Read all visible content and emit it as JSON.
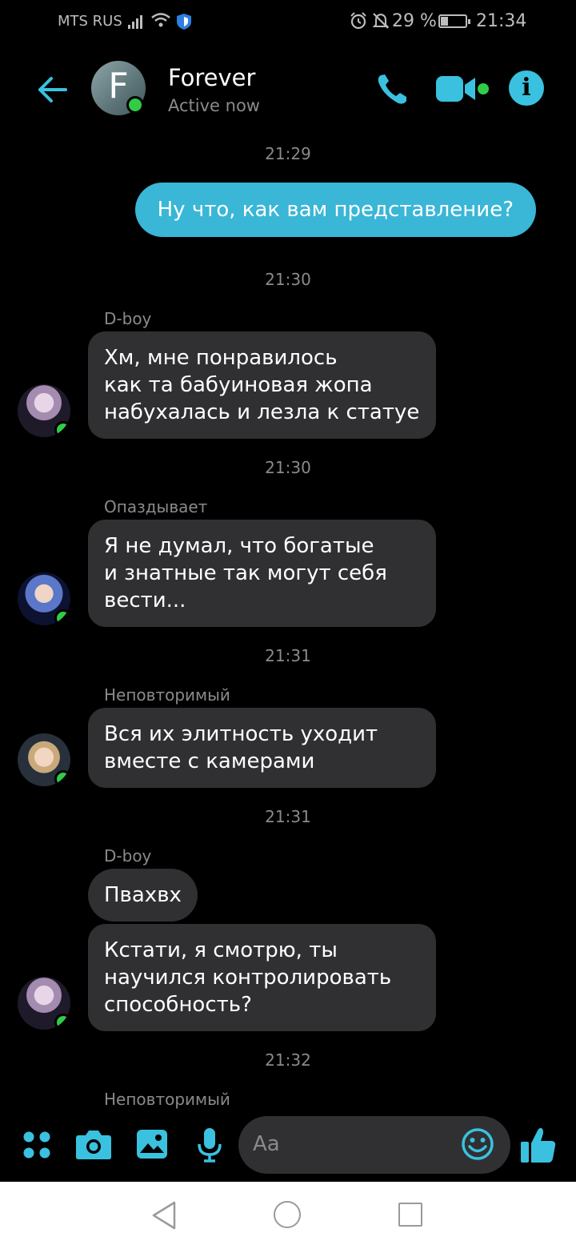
{
  "status_bar": {
    "carrier": "MTS RUS",
    "battery_percent": "29 %",
    "battery_level": 0.29,
    "time": "21:34",
    "icons": [
      "signal-icon",
      "wifi-icon",
      "shield-icon",
      "alarm-icon",
      "bell-off-icon",
      "battery-icon"
    ]
  },
  "header": {
    "avatar_letter": "F",
    "name": "Forever",
    "status": "Active now",
    "icons": [
      "back-arrow-icon",
      "phone-icon",
      "video-icon",
      "info-icon"
    ]
  },
  "accent": "#3ab6d6",
  "messages": [
    {
      "timestamp": "21:29",
      "outgoing": true,
      "text": "Ну что, как вам представление?"
    },
    {
      "timestamp": "21:30",
      "sender": "D-boy",
      "text": "Хм, мне понравилось\nкак та бабуиновая жопа\nнабухалась и лезла к статуе"
    },
    {
      "timestamp": "21:30",
      "sender": "Опаздывает",
      "text": "Я не думал, что богатые\nи знатные так могут себя\nвести..."
    },
    {
      "timestamp": "21:31",
      "sender": "Неповторимый",
      "text": "Вся их элитность уходит\nвместе с камерами"
    },
    {
      "timestamp": "21:31",
      "sender": "D-boy",
      "text": "Пвахвх",
      "text2": "Кстати, я смотрю, ты\nнаучился контролировать\nспособность?"
    },
    {
      "timestamp": "21:32",
      "sender": "Неповторимый"
    }
  ],
  "composer": {
    "placeholder": "Aa",
    "icons": [
      "apps-icon",
      "camera-icon",
      "gallery-icon",
      "microphone-icon",
      "emoji-icon",
      "thumbs-up-icon"
    ]
  },
  "navbar": {
    "icons": [
      "nav-back-icon",
      "nav-home-icon",
      "nav-recents-icon"
    ]
  }
}
